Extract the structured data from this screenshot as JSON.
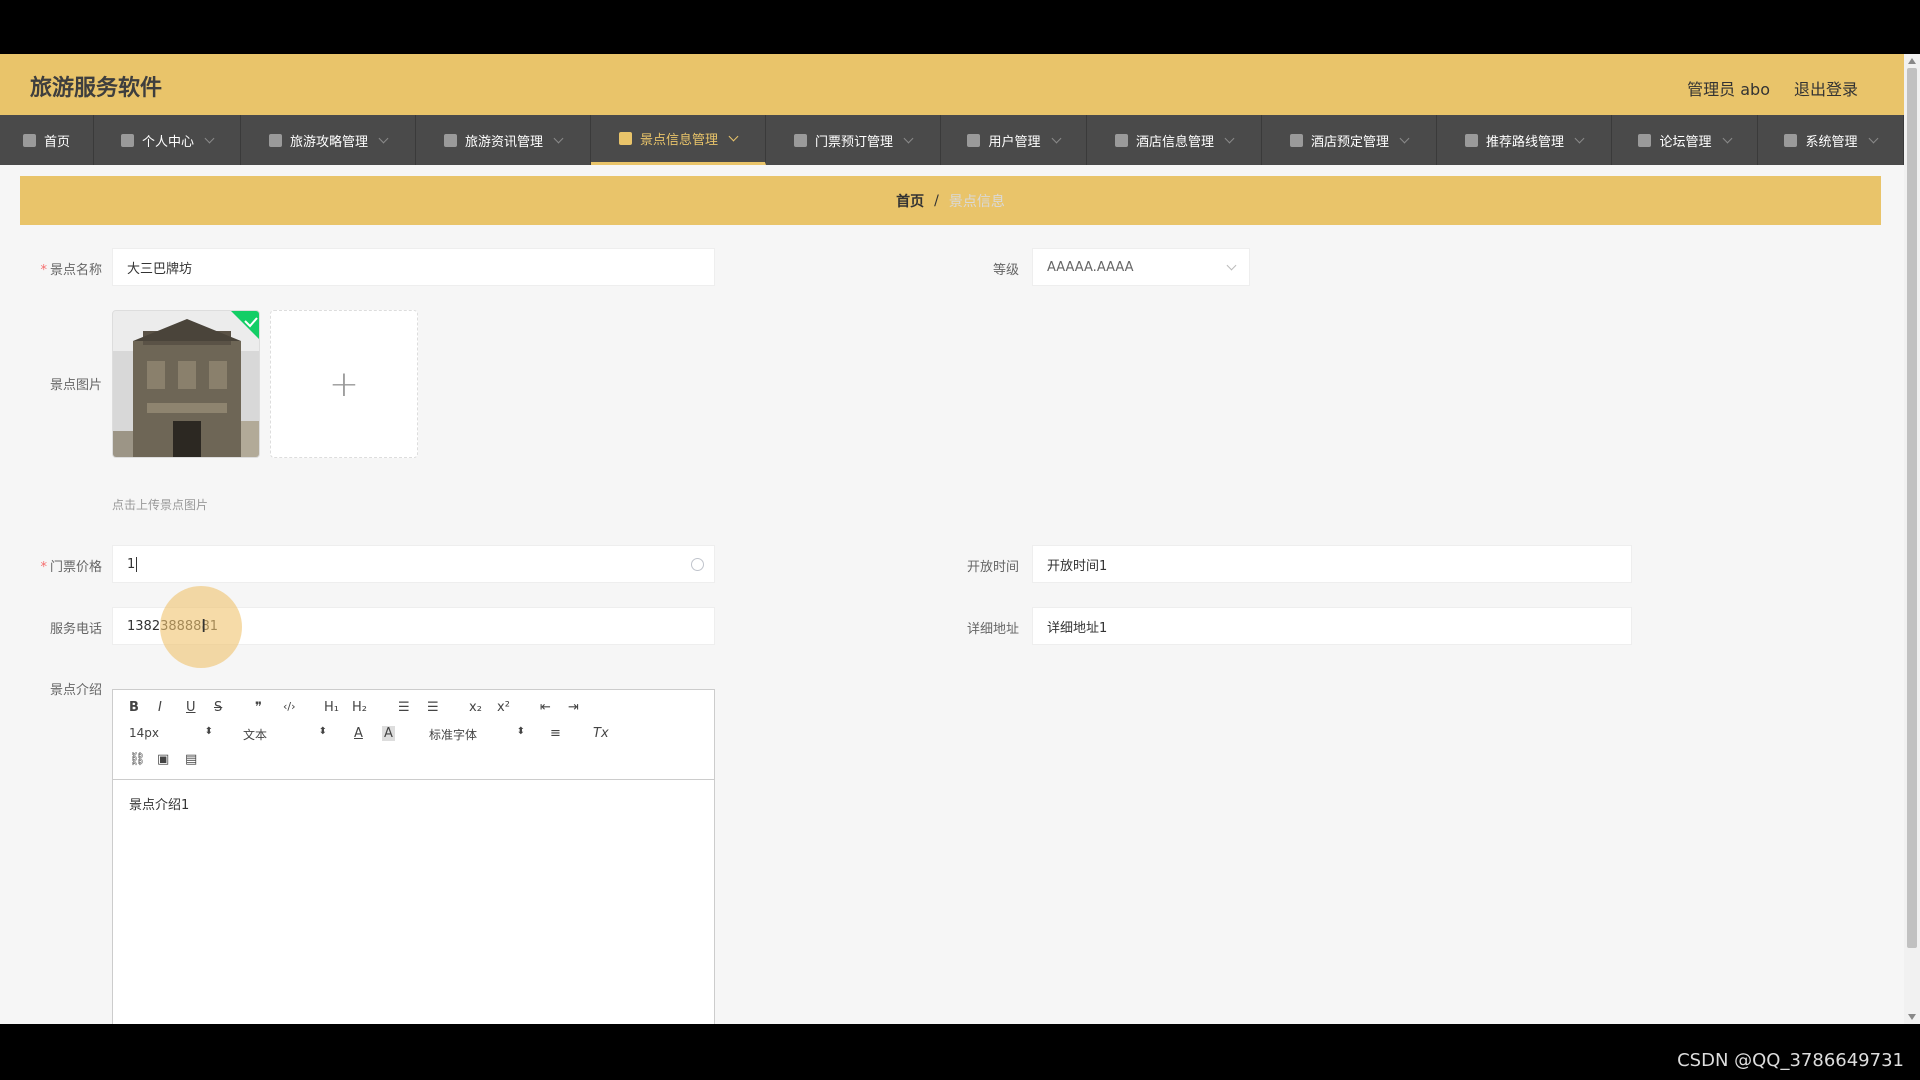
{
  "app": {
    "title": "旅游服务软件",
    "admin": "管理员 abo",
    "logout": "退出登录"
  },
  "nav": {
    "items": [
      {
        "label": "首页",
        "icon": "home-icon"
      },
      {
        "label": "个人中心",
        "icon": "user-icon"
      },
      {
        "label": "旅游攻略管理",
        "icon": "power-icon"
      },
      {
        "label": "旅游资讯管理",
        "icon": "monitor-icon"
      },
      {
        "label": "景点信息管理",
        "icon": "list-icon",
        "active": true
      },
      {
        "label": "门票预订管理",
        "icon": "mic-icon"
      },
      {
        "label": "用户管理",
        "icon": "chat-icon"
      },
      {
        "label": "酒店信息管理",
        "icon": "briefcase-icon"
      },
      {
        "label": "酒店预定管理",
        "icon": "expand-icon"
      },
      {
        "label": "推荐路线管理",
        "icon": "user-icon"
      },
      {
        "label": "论坛管理",
        "icon": "user-icon"
      },
      {
        "label": "系统管理",
        "icon": "grid-icon"
      }
    ]
  },
  "breadcrumb": {
    "home": "首页",
    "sep": "/",
    "current": "景点信息"
  },
  "form": {
    "name_label": "景点名称",
    "name_value": "大三巴牌坊",
    "level_label": "等级",
    "level_value": "AAAAA.AAAA",
    "image_label": "景点图片",
    "upload_tip": "点击上传景点图片",
    "upload_plus": "+",
    "price_label": "门票价格",
    "price_value": "1",
    "open_label": "开放时间",
    "open_value": "开放时间1",
    "phone_label": "服务电话",
    "phone_value": "13823888881",
    "address_label": "详细地址",
    "address_value": "详细地址1",
    "intro_label": "景点介绍",
    "intro_value": "景点介绍1"
  },
  "editor": {
    "bold": "B",
    "italic": "I",
    "underline": "U",
    "strike": "S",
    "quote": "❞",
    "code": "‹/›",
    "h1": "H₁",
    "h2": "H₂",
    "ol": "☰",
    "ul": "☰",
    "sub": "x₂",
    "sup": "x²",
    "outdent": "⇤",
    "indent": "⇥",
    "size": "14px",
    "header": "文本",
    "font_color": "A",
    "bg_color": "A",
    "font": "标准字体",
    "align": "≡",
    "clean": "Tx",
    "link": "⛓",
    "image": "▣",
    "video": "▤",
    "arrow": "⬍"
  },
  "watermark": "CSDN @QQ_3786649731",
  "colors": {
    "accent": "#e9c46a",
    "nav_bg": "#4a4a4a"
  }
}
